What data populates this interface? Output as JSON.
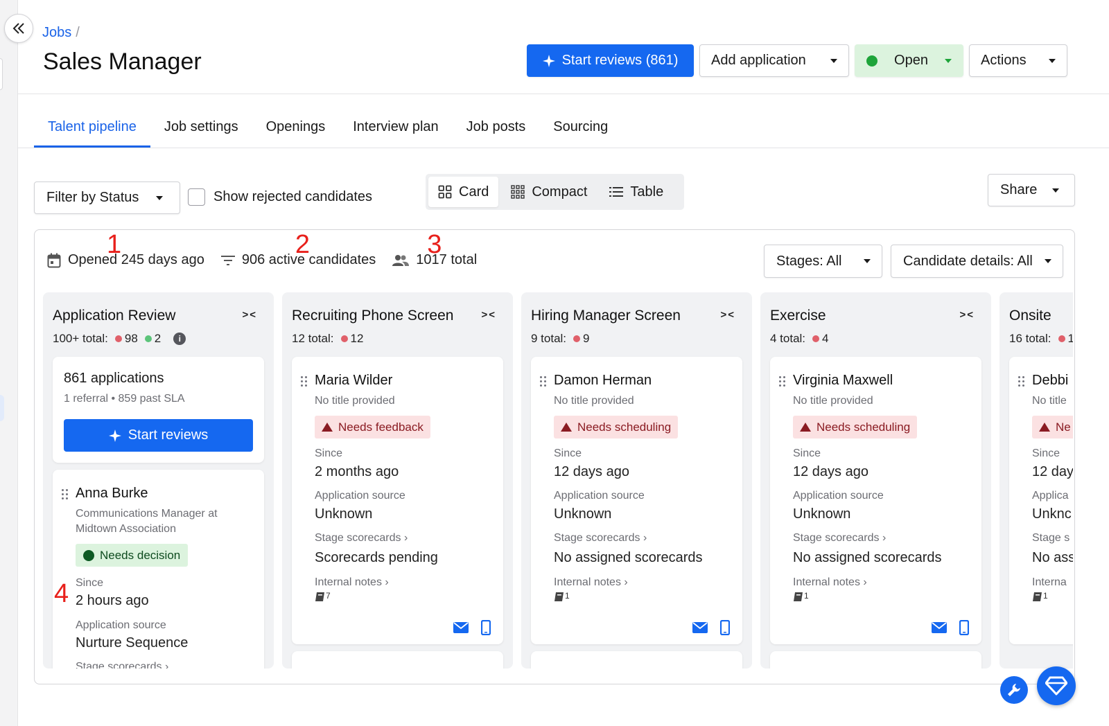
{
  "breadcrumb": {
    "jobs": "Jobs",
    "separator": "/"
  },
  "page": {
    "title": "Sales Manager"
  },
  "header_actions": {
    "start_reviews": "Start reviews (861)",
    "add_application": "Add application",
    "status": "Open",
    "actions": "Actions"
  },
  "tabs": [
    {
      "label": "Talent pipeline",
      "active": true
    },
    {
      "label": "Job settings"
    },
    {
      "label": "Openings"
    },
    {
      "label": "Interview plan"
    },
    {
      "label": "Job posts"
    },
    {
      "label": "Sourcing"
    }
  ],
  "toolbar": {
    "filter_status": "Filter by Status",
    "show_rejected": "Show rejected candidates",
    "views": [
      "Card",
      "Compact",
      "Table"
    ],
    "active_view": "Card",
    "share": "Share"
  },
  "stats": {
    "opened": "Opened 245 days ago",
    "active": "906 active candidates",
    "total": "1017 total"
  },
  "annotations": [
    "1",
    "2",
    "3",
    "4"
  ],
  "board_filters": {
    "stages": "Stages: All",
    "candidate_details": "Candidate details: All"
  },
  "columns": [
    {
      "title": "Application Review",
      "count_label": "100+ total:",
      "red_count": "98",
      "green_count": "2",
      "apps_card": {
        "title": "861 applications",
        "subtitle": "1 referral • 859 past SLA",
        "button": "Start reviews"
      },
      "candidate": {
        "name": "Anna Burke",
        "subtitle": "Communications Manager at Midtown Association",
        "badge": "Needs decision",
        "since_label": "Since",
        "since": "2 hours ago",
        "source_label": "Application source",
        "source": "Nurture Sequence",
        "scorecards_label": "Stage scorecards ›"
      }
    },
    {
      "title": "Recruiting Phone Screen",
      "count_label": "12 total:",
      "red_count": "12",
      "candidate": {
        "name": "Maria Wilder",
        "subtitle": "No title provided",
        "badge": "Needs feedback",
        "since_label": "Since",
        "since": "2 months ago",
        "source_label": "Application source",
        "source": "Unknown",
        "scorecards_label": "Stage scorecards ›",
        "scorecards": "Scorecards pending",
        "notes_label": "Internal notes ›",
        "notes_count": "7"
      }
    },
    {
      "title": "Hiring Manager Screen",
      "count_label": "9 total:",
      "red_count": "9",
      "candidate": {
        "name": "Damon Herman",
        "subtitle": "No title provided",
        "badge": "Needs scheduling",
        "since_label": "Since",
        "since": "12 days ago",
        "source_label": "Application source",
        "source": "Unknown",
        "scorecards_label": "Stage scorecards ›",
        "scorecards": "No assigned scorecards",
        "notes_label": "Internal notes ›",
        "notes_count": "1"
      }
    },
    {
      "title": "Exercise",
      "count_label": "4 total:",
      "red_count": "4",
      "candidate": {
        "name": "Virginia Maxwell",
        "subtitle": "No title provided",
        "badge": "Needs scheduling",
        "since_label": "Since",
        "since": "12 days ago",
        "source_label": "Application source",
        "source": "Unknown",
        "scorecards_label": "Stage scorecards ›",
        "scorecards": "No assigned scorecards",
        "notes_label": "Internal notes ›",
        "notes_count": "1"
      }
    },
    {
      "title": "Onsite",
      "count_label": "16 total:",
      "red_count": "1",
      "candidate": {
        "name": "Debbi",
        "subtitle": "No title",
        "badge": "Ne",
        "since_label": "Since",
        "since": "12 day",
        "source_label": "Applica",
        "source": "Unknc",
        "scorecards_label": "Stage s",
        "scorecards": "No ass",
        "notes_label": "Interna",
        "notes_count": "1"
      }
    }
  ],
  "icons": {
    "collapse_sidebar": "double-chevron-left-icon",
    "sparkle": "sparkle-icon",
    "calendar": "calendar-icon",
    "filter": "filter-lines-icon",
    "people": "people-icon",
    "email": "email-icon",
    "phone": "phone-icon",
    "notes": "notebook-icon",
    "wrench": "wrench-icon",
    "gem": "gem-icon"
  },
  "colors": {
    "accent": "#1568f0",
    "link": "#1a63e8",
    "open_green": "#1ea43a",
    "alert_red": "#8a1b22",
    "annotation": "#e8201b"
  }
}
